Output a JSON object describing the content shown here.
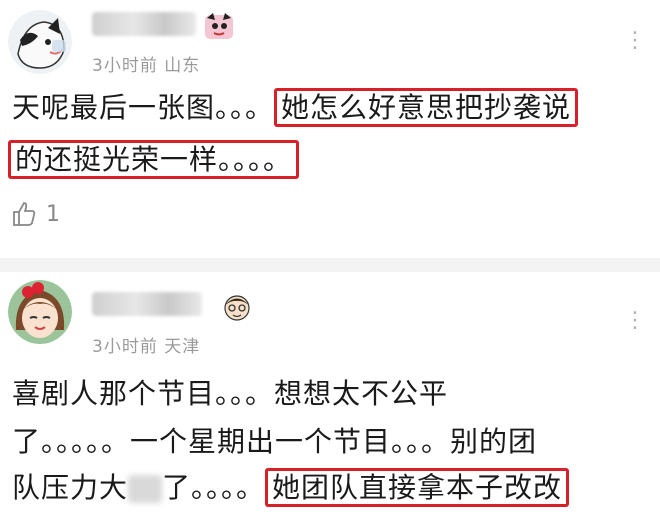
{
  "comments": [
    {
      "meta": "3小时前 山东",
      "text_line1_a": "天呢最后一张图。。。",
      "text_line1_b": "她怎么好意思把抄袭说",
      "text_line2": "的还挺光荣一样。。。。",
      "likes": "1",
      "avatar_icon": "cartoon-cat-avatar",
      "badge_icon": "anime-badge-icon"
    },
    {
      "meta": "3小时前 天津",
      "text_line1": "喜剧人那个节目。。。想想太不公平",
      "text_line2": "了。。。。。一个星期出一个节目。。。别的团",
      "text_line3_a": "队压力大",
      "text_line3_b": "了。。。。",
      "text_line3_c": "她团队直接拿本子改改",
      "avatar_icon": "girl-avatar",
      "badge_icon": "cartoon-face-badge-icon"
    }
  ],
  "colors": {
    "highlight_box": "#d8202a",
    "meta_text": "#9a9a9a",
    "divider": "#f3f3f3"
  }
}
